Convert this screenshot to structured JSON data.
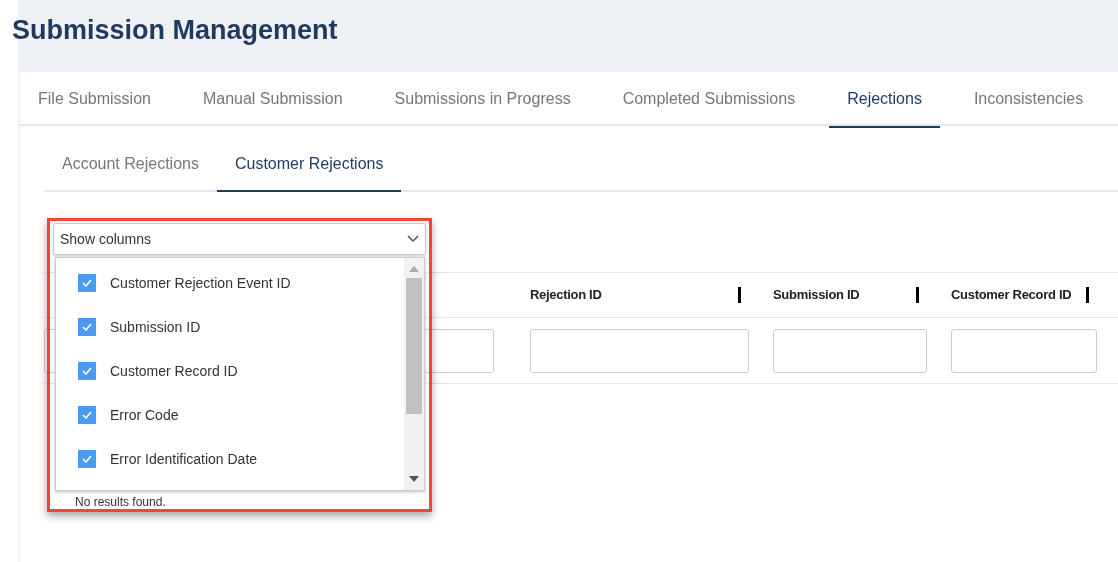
{
  "title": "Submission Management",
  "tabs": [
    {
      "label": "File Submission",
      "selected": false
    },
    {
      "label": "Manual Submission",
      "selected": false
    },
    {
      "label": "Submissions in Progress",
      "selected": false
    },
    {
      "label": "Completed Submissions",
      "selected": false
    },
    {
      "label": "Rejections",
      "selected": true
    },
    {
      "label": "Inconsistencies",
      "selected": false
    }
  ],
  "subtabs": [
    {
      "label": "Account Rejections",
      "selected": false
    },
    {
      "label": "Customer Rejections",
      "selected": true
    }
  ],
  "table": {
    "columns": [
      {
        "label": "Rejection ID"
      },
      {
        "label": "Submission ID"
      },
      {
        "label": "Customer Record ID"
      }
    ],
    "empty_message": "No results found."
  },
  "column_picker": {
    "label": "Show columns",
    "options": [
      {
        "label": "Customer Rejection Event ID",
        "checked": true
      },
      {
        "label": "Submission ID",
        "checked": true
      },
      {
        "label": "Customer Record ID",
        "checked": true
      },
      {
        "label": "Error Code",
        "checked": true
      },
      {
        "label": "Error Identification Date",
        "checked": true
      }
    ]
  }
}
